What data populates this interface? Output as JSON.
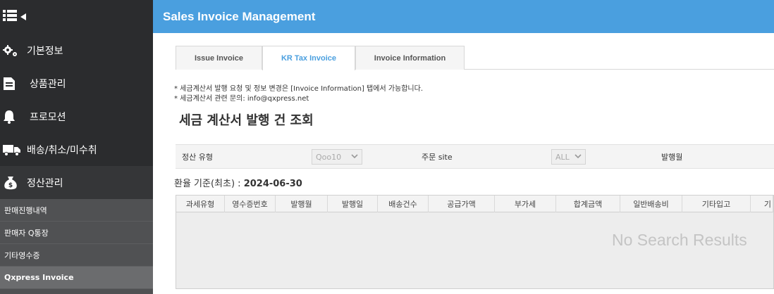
{
  "header": {
    "title": "Sales Invoice Management"
  },
  "sidebar": {
    "items": [
      {
        "label": "기본정보",
        "icon": "gears-icon"
      },
      {
        "label": "상품관리",
        "icon": "document-icon"
      },
      {
        "label": "프로모션",
        "icon": "bell-icon"
      },
      {
        "label": "배송/취소/미수취",
        "icon": "truck-icon"
      },
      {
        "label": "정산관리",
        "icon": "money-bag-icon"
      }
    ],
    "subitems": [
      {
        "label": "판매진행내역"
      },
      {
        "label": "판매자 Q통장"
      },
      {
        "label": "기타영수증"
      },
      {
        "label": "Qxpress Invoice"
      }
    ]
  },
  "tabs": [
    {
      "label": "Issue Invoice",
      "active": false
    },
    {
      "label": "KR Tax Invoice",
      "active": true
    },
    {
      "label": "Invoice Information",
      "active": false
    }
  ],
  "notes": [
    "* 세금계산서 발행 요청 및 정보 변경은 [Invoice Information] 탭에서 가능합니다.",
    "* 세금계산서 관련 문의: info@qxpress.net"
  ],
  "section_title": "세금 계산서 발행 건 조회",
  "filter": {
    "settlement_type_label": "정산 유형",
    "settlement_type_value": "Qoo10",
    "order_site_label": "주문 site",
    "order_site_value": "ALL",
    "issue_month_label": "발행월"
  },
  "exchange_rate": {
    "label": "환율 기준(최초) : ",
    "date": "2024-06-30"
  },
  "table": {
    "columns": [
      "과세유형",
      "영수증번호",
      "발행월",
      "발행일",
      "배송건수",
      "공급가액",
      "부가세",
      "합계금액",
      "일반배송비",
      "기타입고",
      "기"
    ],
    "empty_text": "No Search Results"
  },
  "colors": {
    "header": "#4a9fdf",
    "sidebar": "#2b2c2e",
    "active_tab_text": "#4a9fdf"
  }
}
